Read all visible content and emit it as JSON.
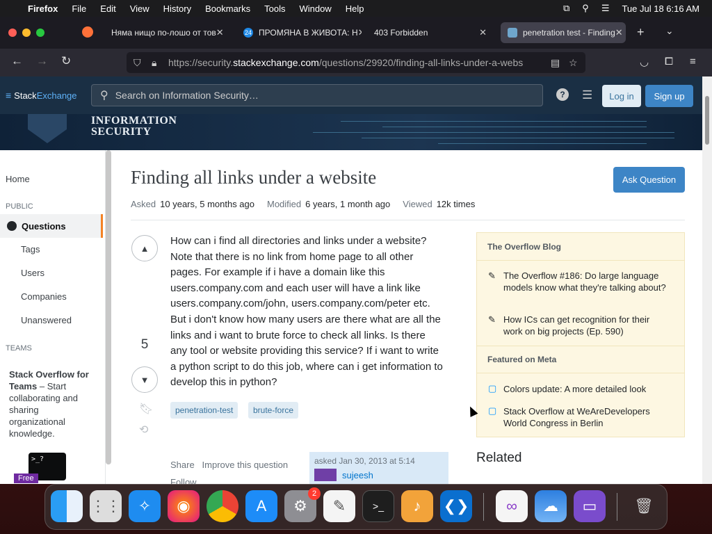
{
  "menubar": {
    "apple": "",
    "app": "Firefox",
    "items": [
      "File",
      "Edit",
      "View",
      "History",
      "Bookmarks",
      "Tools",
      "Window",
      "Help"
    ],
    "clock": "Tue Jul 18  6:16 AM"
  },
  "tabs": [
    {
      "label": "Няма нищо по-лошо от тов"
    },
    {
      "label": "ПРОМЯНА В ЖИВОТА: Н",
      "badge": "24"
    },
    {
      "label": "403 Forbidden"
    },
    {
      "label": "penetration test - Finding"
    }
  ],
  "url": {
    "prefix": "https://security.",
    "domain": "stackexchange.com",
    "path": "/questions/29920/finding-all-links-under-a-webs"
  },
  "header": {
    "logo_a": "Stack",
    "logo_b": "Exchange",
    "search_placeholder": "Search on Information Security…",
    "login": "Log in",
    "signup": "Sign up"
  },
  "banner": {
    "line1": "INFORMATION",
    "line2": "SECURITY"
  },
  "sidebar": {
    "home": "Home",
    "public": "PUBLIC",
    "questions": "Questions",
    "tags": "Tags",
    "users": "Users",
    "companies": "Companies",
    "unanswered": "Unanswered",
    "teams": "TEAMS",
    "teams_title": "Stack Overflow for Teams",
    "teams_text": " – Start collaborating and sharing organizational knowledge.",
    "free": "Free"
  },
  "question": {
    "title": "Finding all links under a website",
    "ask_button": "Ask Question",
    "asked_label": "Asked",
    "asked_value": "10 years, 5 months ago",
    "modified_label": "Modified",
    "modified_value": "6 years, 1 month ago",
    "viewed_label": "Viewed",
    "viewed_value": "12k times",
    "score": "5",
    "body": "How can i find all directories and links under a website? Note that there is no link from home page to all other pages. For example if i have a domain like this users.company.com and each user will have a link like users.company.com/john, users.company.com/peter etc. But i don't know how many users are there what are all the links and i want to brute force to check all links. Is there any tool or website providing this service? If i want to write a python script to do this job, where can i get information to develop this in python?",
    "tags": [
      "penetration-test",
      "brute-force"
    ],
    "share": "Share",
    "improve": "Improve this question",
    "follow": "Follow",
    "asked_on": "asked Jan 30, 2013 at 5:14",
    "user": "sujeesh"
  },
  "blog": {
    "heading": "The Overflow Blog",
    "items": [
      "The Overflow #186: Do large language models know what they're talking about?",
      "How ICs can get recognition for their work on big projects (Ep. 590)"
    ],
    "meta_heading": "Featured on Meta",
    "meta_items": [
      "Colors update: A more detailed look",
      "Stack Overflow at WeAreDevelopers World Congress in Berlin"
    ]
  },
  "related": "Related",
  "dock": {
    "badge": "2",
    "items": [
      "finder-icon",
      "launchpad-icon",
      "safari-icon",
      "firefox-icon",
      "chrome-icon",
      "app-store-icon",
      "system-settings-icon",
      "textedit-icon",
      "terminal-icon",
      "garageband-icon",
      "vscode-icon",
      "visual-studio-icon",
      "weather-icon",
      "simulator-icon",
      "trash-icon"
    ]
  }
}
